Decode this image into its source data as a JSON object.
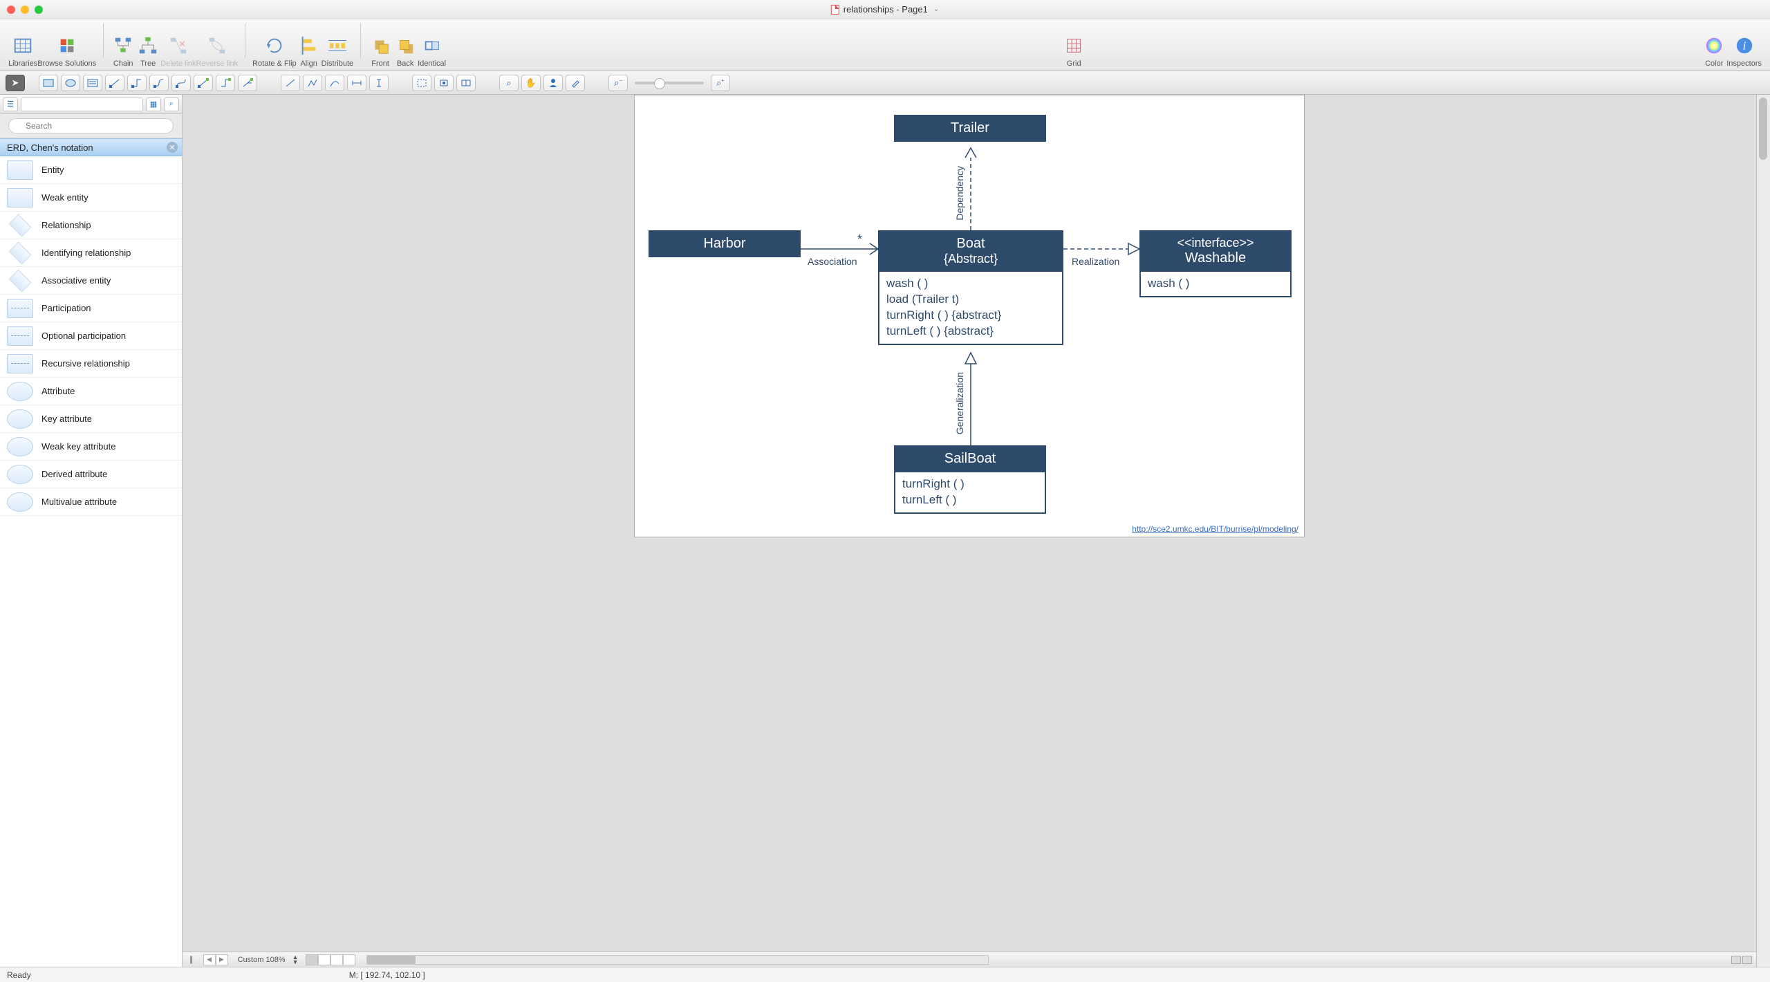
{
  "window": {
    "title": "relationships - Page1"
  },
  "toolbar": {
    "libraries": "Libraries",
    "browse": "Browse Solutions",
    "chain": "Chain",
    "tree": "Tree",
    "delete_link": "Delete link",
    "reverse_link": "Reverse link",
    "rotate_flip": "Rotate & Flip",
    "align": "Align",
    "distribute": "Distribute",
    "front": "Front",
    "back": "Back",
    "identical": "Identical",
    "grid": "Grid",
    "color": "Color",
    "inspectors": "Inspectors"
  },
  "sidebar": {
    "search_placeholder": "Search",
    "panel_title": "ERD, Chen's notation",
    "items": [
      {
        "label": "Entity",
        "shape": "rect"
      },
      {
        "label": "Weak entity",
        "shape": "rect"
      },
      {
        "label": "Relationship",
        "shape": "diamond"
      },
      {
        "label": "Identifying relationship",
        "shape": "diamond"
      },
      {
        "label": "Associative entity",
        "shape": "diamond"
      },
      {
        "label": "Participation",
        "shape": "half"
      },
      {
        "label": "Optional participation",
        "shape": "half"
      },
      {
        "label": "Recursive relationship",
        "shape": "half"
      },
      {
        "label": "Attribute",
        "shape": "ellipse"
      },
      {
        "label": "Key attribute",
        "shape": "ellipse"
      },
      {
        "label": "Weak key attribute",
        "shape": "ellipse"
      },
      {
        "label": "Derived attribute",
        "shape": "ellipse"
      },
      {
        "label": "Multivalue attribute",
        "shape": "ellipse"
      }
    ]
  },
  "diagram": {
    "trailer": {
      "title": "Trailer"
    },
    "harbor": {
      "title": "Harbor"
    },
    "boat": {
      "title": "Boat",
      "subtitle": "{Abstract}",
      "methods": [
        "wash ( )",
        "load (Trailer t)",
        "turnRight ( ) {abstract}",
        "turnLeft ( ) {abstract}"
      ]
    },
    "washable": {
      "stereo": "<<interface>>",
      "title": "Washable",
      "methods": [
        "wash ( )"
      ]
    },
    "sailboat": {
      "title": "SailBoat",
      "methods": [
        "turnRight ( )",
        "turnLeft ( )"
      ]
    },
    "labels": {
      "dependency": "Dependency",
      "association": "Association",
      "star": "*",
      "realization": "Realization",
      "generalization": "Generalization"
    },
    "link": "http://sce2.umkc.edu/BIT/burrise/pl/modeling/"
  },
  "bottom": {
    "zoom": "Custom 108%"
  },
  "status": {
    "ready": "Ready",
    "coords": "M: [ 192.74, 102.10 ]"
  }
}
